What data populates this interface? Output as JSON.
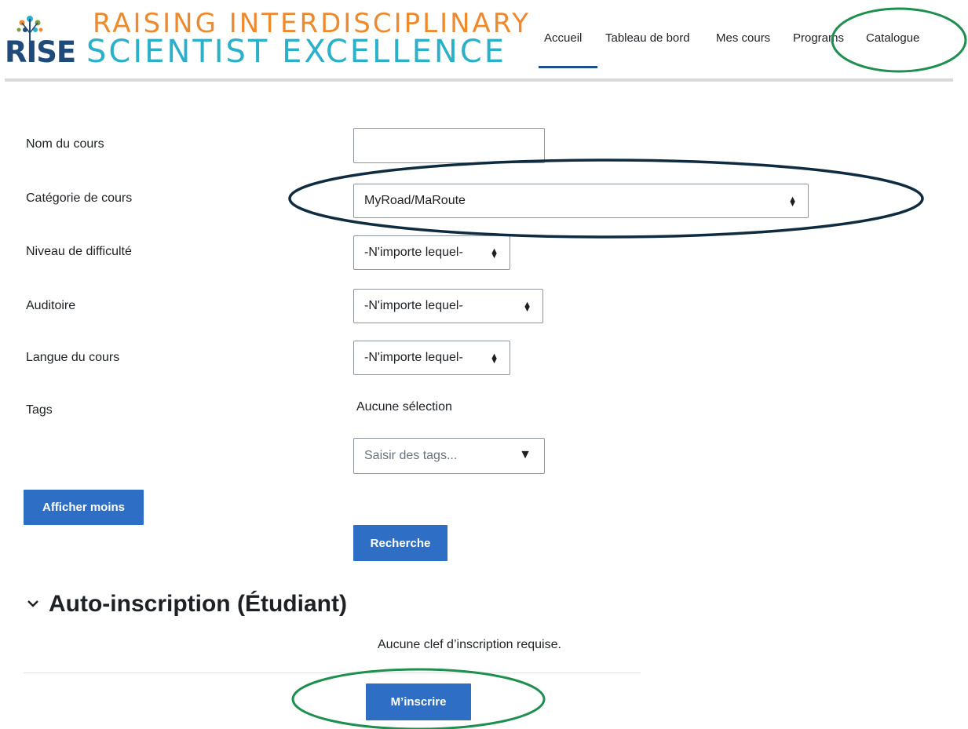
{
  "branding": {
    "line1": "RAISING INTERDISCIPLINARY",
    "rise": "RISE",
    "line2": "SCIENTIST EXCELLENCE"
  },
  "nav": {
    "items": [
      "Accueil",
      "Tableau de bord",
      "Mes cours",
      "Programs",
      "Catalogue"
    ],
    "active": "Accueil"
  },
  "form": {
    "course_name_label": "Nom du cours",
    "course_name_value": "",
    "category_label": "Catégorie de cours",
    "category_value": "MyRoad/MaRoute",
    "difficulty_label": "Niveau de difficulté",
    "difficulty_value": "-N'importe lequel-",
    "audience_label": "Auditoire",
    "audience_value": "-N'importe lequel-",
    "language_label": "Langue du cours",
    "language_value": "-N'importe lequel-",
    "tags_label": "Tags",
    "tags_selection": "Aucune sélection",
    "tags_placeholder": "Saisir des tags..."
  },
  "buttons": {
    "show_less": "Afficher moins",
    "search": "Recherche",
    "enrol": "M’inscrire"
  },
  "enrolment": {
    "title": "Auto-inscription (Étudiant)",
    "note": "Aucune clef d’inscription requise."
  },
  "colors": {
    "primary": "#2e6fc5",
    "annotation_green": "#1e8f4e",
    "annotation_navy": "#0f2b40",
    "logo_orange": "#ee8a2e",
    "logo_teal": "#2bb0c9",
    "logo_navy": "#1e4b7a"
  }
}
